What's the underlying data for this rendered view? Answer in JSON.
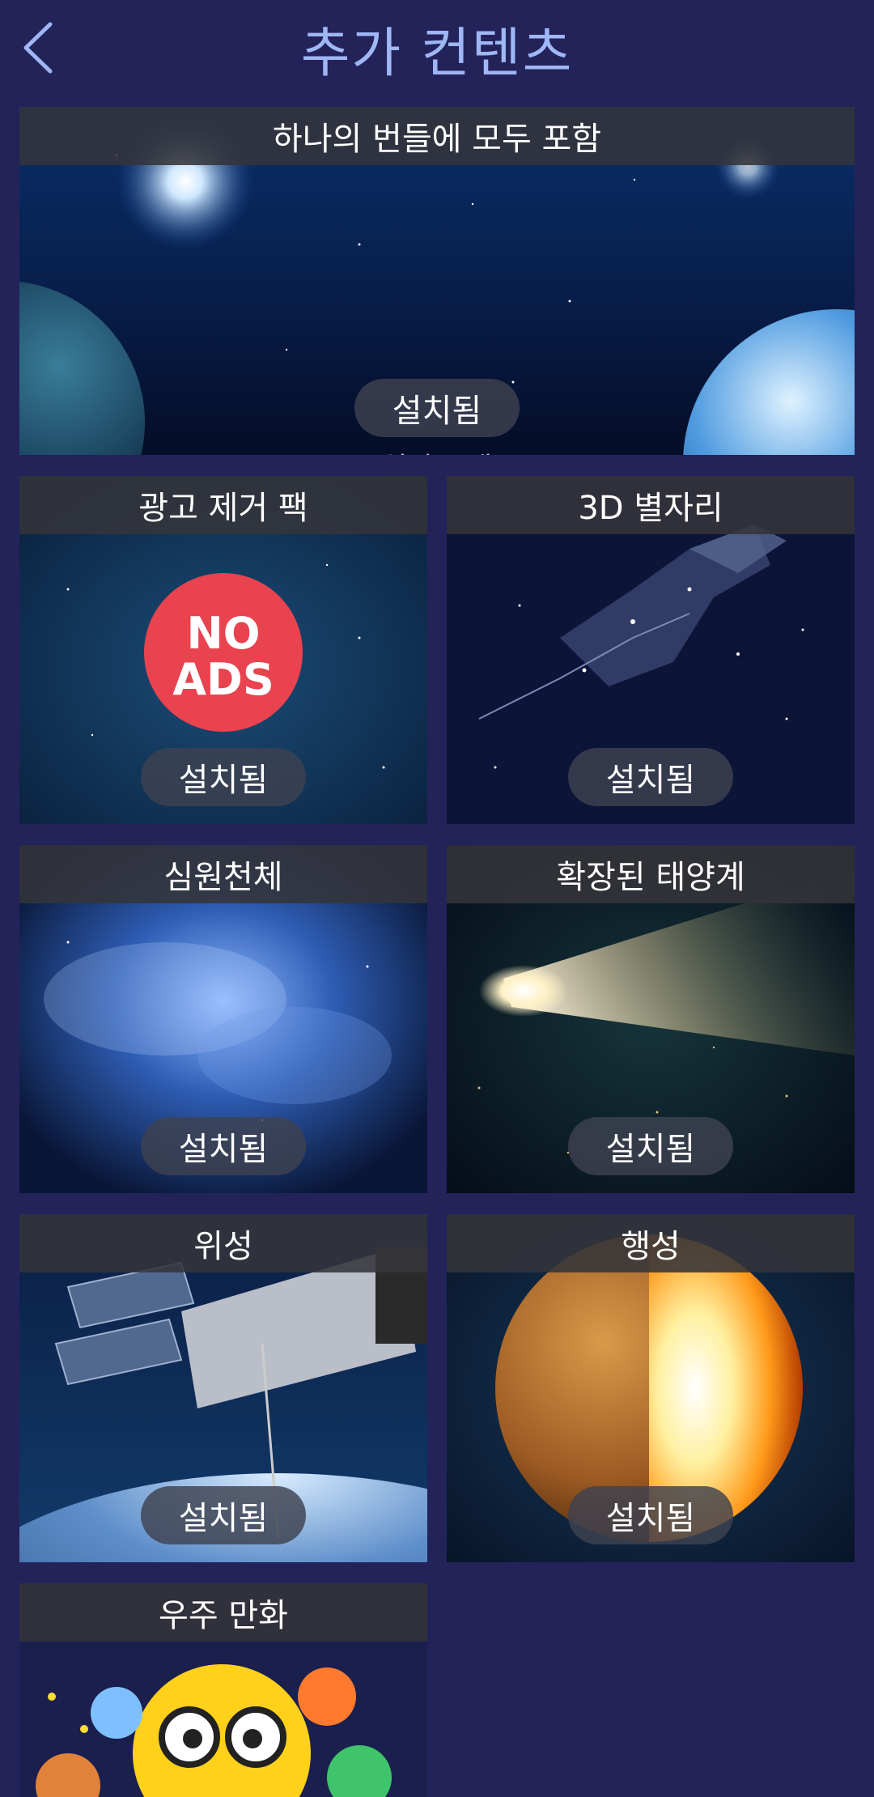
{
  "header": {
    "title": "추가 컨텐츠",
    "back_icon": "chevron-left-icon"
  },
  "bundle": {
    "title": "하나의 번들에 모두 포함",
    "purchase_type": "일시 구매",
    "status": "설치됨"
  },
  "packs": [
    {
      "title": "광고 제거 팩",
      "status": "설치됨",
      "badge": [
        "NO",
        "ADS"
      ]
    },
    {
      "title": "3D 별자리",
      "status": "설치됨"
    },
    {
      "title": "심원천체",
      "status": "설치됨"
    },
    {
      "title": "확장된 태양계",
      "status": "설치됨"
    },
    {
      "title": "위성",
      "status": "설치됨"
    },
    {
      "title": "행성",
      "status": "설치됨"
    },
    {
      "title": "우주 만화"
    }
  ],
  "colors": {
    "background": "#23235a",
    "title_accent": "#9fb7f5",
    "no_ads_badge": "#e8434f"
  }
}
